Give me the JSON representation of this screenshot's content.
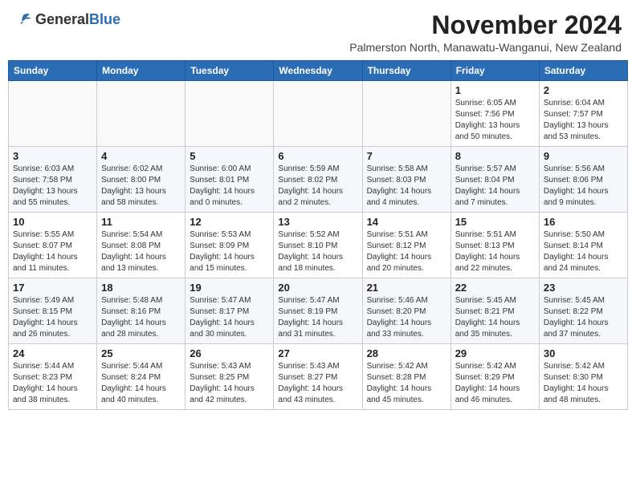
{
  "header": {
    "logo_general": "General",
    "logo_blue": "Blue",
    "month_title": "November 2024",
    "subtitle": "Palmerston North, Manawatu-Wanganui, New Zealand"
  },
  "weekdays": [
    "Sunday",
    "Monday",
    "Tuesday",
    "Wednesday",
    "Thursday",
    "Friday",
    "Saturday"
  ],
  "weeks": [
    [
      {
        "day": "",
        "info": ""
      },
      {
        "day": "",
        "info": ""
      },
      {
        "day": "",
        "info": ""
      },
      {
        "day": "",
        "info": ""
      },
      {
        "day": "",
        "info": ""
      },
      {
        "day": "1",
        "info": "Sunrise: 6:05 AM\nSunset: 7:56 PM\nDaylight: 13 hours\nand 50 minutes."
      },
      {
        "day": "2",
        "info": "Sunrise: 6:04 AM\nSunset: 7:57 PM\nDaylight: 13 hours\nand 53 minutes."
      }
    ],
    [
      {
        "day": "3",
        "info": "Sunrise: 6:03 AM\nSunset: 7:58 PM\nDaylight: 13 hours\nand 55 minutes."
      },
      {
        "day": "4",
        "info": "Sunrise: 6:02 AM\nSunset: 8:00 PM\nDaylight: 13 hours\nand 58 minutes."
      },
      {
        "day": "5",
        "info": "Sunrise: 6:00 AM\nSunset: 8:01 PM\nDaylight: 14 hours\nand 0 minutes."
      },
      {
        "day": "6",
        "info": "Sunrise: 5:59 AM\nSunset: 8:02 PM\nDaylight: 14 hours\nand 2 minutes."
      },
      {
        "day": "7",
        "info": "Sunrise: 5:58 AM\nSunset: 8:03 PM\nDaylight: 14 hours\nand 4 minutes."
      },
      {
        "day": "8",
        "info": "Sunrise: 5:57 AM\nSunset: 8:04 PM\nDaylight: 14 hours\nand 7 minutes."
      },
      {
        "day": "9",
        "info": "Sunrise: 5:56 AM\nSunset: 8:06 PM\nDaylight: 14 hours\nand 9 minutes."
      }
    ],
    [
      {
        "day": "10",
        "info": "Sunrise: 5:55 AM\nSunset: 8:07 PM\nDaylight: 14 hours\nand 11 minutes."
      },
      {
        "day": "11",
        "info": "Sunrise: 5:54 AM\nSunset: 8:08 PM\nDaylight: 14 hours\nand 13 minutes."
      },
      {
        "day": "12",
        "info": "Sunrise: 5:53 AM\nSunset: 8:09 PM\nDaylight: 14 hours\nand 15 minutes."
      },
      {
        "day": "13",
        "info": "Sunrise: 5:52 AM\nSunset: 8:10 PM\nDaylight: 14 hours\nand 18 minutes."
      },
      {
        "day": "14",
        "info": "Sunrise: 5:51 AM\nSunset: 8:12 PM\nDaylight: 14 hours\nand 20 minutes."
      },
      {
        "day": "15",
        "info": "Sunrise: 5:51 AM\nSunset: 8:13 PM\nDaylight: 14 hours\nand 22 minutes."
      },
      {
        "day": "16",
        "info": "Sunrise: 5:50 AM\nSunset: 8:14 PM\nDaylight: 14 hours\nand 24 minutes."
      }
    ],
    [
      {
        "day": "17",
        "info": "Sunrise: 5:49 AM\nSunset: 8:15 PM\nDaylight: 14 hours\nand 26 minutes."
      },
      {
        "day": "18",
        "info": "Sunrise: 5:48 AM\nSunset: 8:16 PM\nDaylight: 14 hours\nand 28 minutes."
      },
      {
        "day": "19",
        "info": "Sunrise: 5:47 AM\nSunset: 8:17 PM\nDaylight: 14 hours\nand 30 minutes."
      },
      {
        "day": "20",
        "info": "Sunrise: 5:47 AM\nSunset: 8:19 PM\nDaylight: 14 hours\nand 31 minutes."
      },
      {
        "day": "21",
        "info": "Sunrise: 5:46 AM\nSunset: 8:20 PM\nDaylight: 14 hours\nand 33 minutes."
      },
      {
        "day": "22",
        "info": "Sunrise: 5:45 AM\nSunset: 8:21 PM\nDaylight: 14 hours\nand 35 minutes."
      },
      {
        "day": "23",
        "info": "Sunrise: 5:45 AM\nSunset: 8:22 PM\nDaylight: 14 hours\nand 37 minutes."
      }
    ],
    [
      {
        "day": "24",
        "info": "Sunrise: 5:44 AM\nSunset: 8:23 PM\nDaylight: 14 hours\nand 38 minutes."
      },
      {
        "day": "25",
        "info": "Sunrise: 5:44 AM\nSunset: 8:24 PM\nDaylight: 14 hours\nand 40 minutes."
      },
      {
        "day": "26",
        "info": "Sunrise: 5:43 AM\nSunset: 8:25 PM\nDaylight: 14 hours\nand 42 minutes."
      },
      {
        "day": "27",
        "info": "Sunrise: 5:43 AM\nSunset: 8:27 PM\nDaylight: 14 hours\nand 43 minutes."
      },
      {
        "day": "28",
        "info": "Sunrise: 5:42 AM\nSunset: 8:28 PM\nDaylight: 14 hours\nand 45 minutes."
      },
      {
        "day": "29",
        "info": "Sunrise: 5:42 AM\nSunset: 8:29 PM\nDaylight: 14 hours\nand 46 minutes."
      },
      {
        "day": "30",
        "info": "Sunrise: 5:42 AM\nSunset: 8:30 PM\nDaylight: 14 hours\nand 48 minutes."
      }
    ]
  ]
}
